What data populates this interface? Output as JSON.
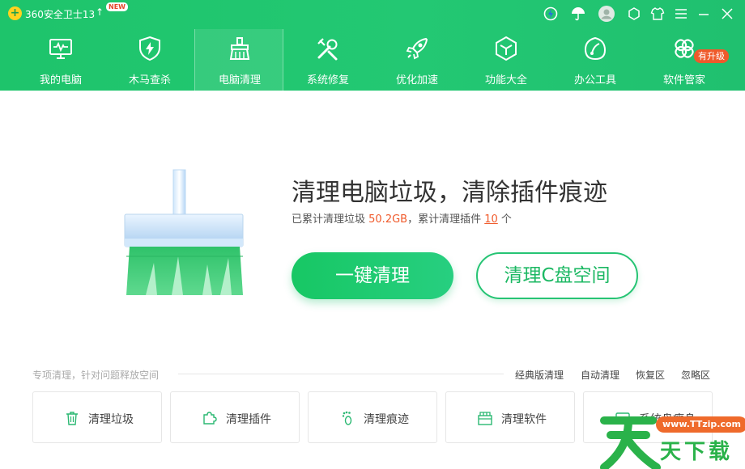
{
  "app": {
    "title": "360安全卫士13",
    "logo_glyph": "+",
    "upgrade_glyph": "↑",
    "new_badge": "NEW"
  },
  "titlebar_icons": [
    "speed-ball-icon",
    "umbrella-icon",
    "avatar",
    "skin-icon",
    "shirt-icon",
    "menu-icon",
    "minimize-icon",
    "close-icon"
  ],
  "nav": {
    "items": [
      {
        "label": "我的电脑",
        "icon": "monitor-icon"
      },
      {
        "label": "木马查杀",
        "icon": "shield-bolt-icon"
      },
      {
        "label": "电脑清理",
        "icon": "broom-icon",
        "active": true
      },
      {
        "label": "系统修复",
        "icon": "tools-icon"
      },
      {
        "label": "优化加速",
        "icon": "rocket-icon"
      },
      {
        "label": "功能大全",
        "icon": "cube-icon"
      },
      {
        "label": "办公工具",
        "icon": "leaf-icon"
      },
      {
        "label": "软件管家",
        "icon": "flower-icon"
      }
    ],
    "upgrade_badge": "有升级"
  },
  "main": {
    "title": "清理电脑垃圾，清除插件痕迹",
    "stats_prefix": "已累计清理垃圾 ",
    "junk_size": "50.2GB",
    "stats_middle": "，累计清理插件 ",
    "plugin_count": "10",
    "stats_suffix": " 个",
    "primary_button": "一键清理",
    "secondary_button": "清理C盘空间"
  },
  "section": {
    "hint": "专项清理，针对问题释放空间",
    "links": [
      "经典版清理",
      "自动清理",
      "恢复区",
      "忽略区"
    ],
    "cards": [
      {
        "label": "清理垃圾",
        "icon": "trash-icon"
      },
      {
        "label": "清理插件",
        "icon": "puzzle-icon"
      },
      {
        "label": "清理痕迹",
        "icon": "footprint-icon"
      },
      {
        "label": "清理软件",
        "icon": "box-icon"
      },
      {
        "label": "系统盘瘦身",
        "icon": "disk-icon"
      }
    ]
  },
  "watermark": {
    "url": "www.TTzip.com",
    "text": "天下载"
  },
  "colors": {
    "brand_green": "#22c46e",
    "accent_orange": "#f05a2b"
  }
}
